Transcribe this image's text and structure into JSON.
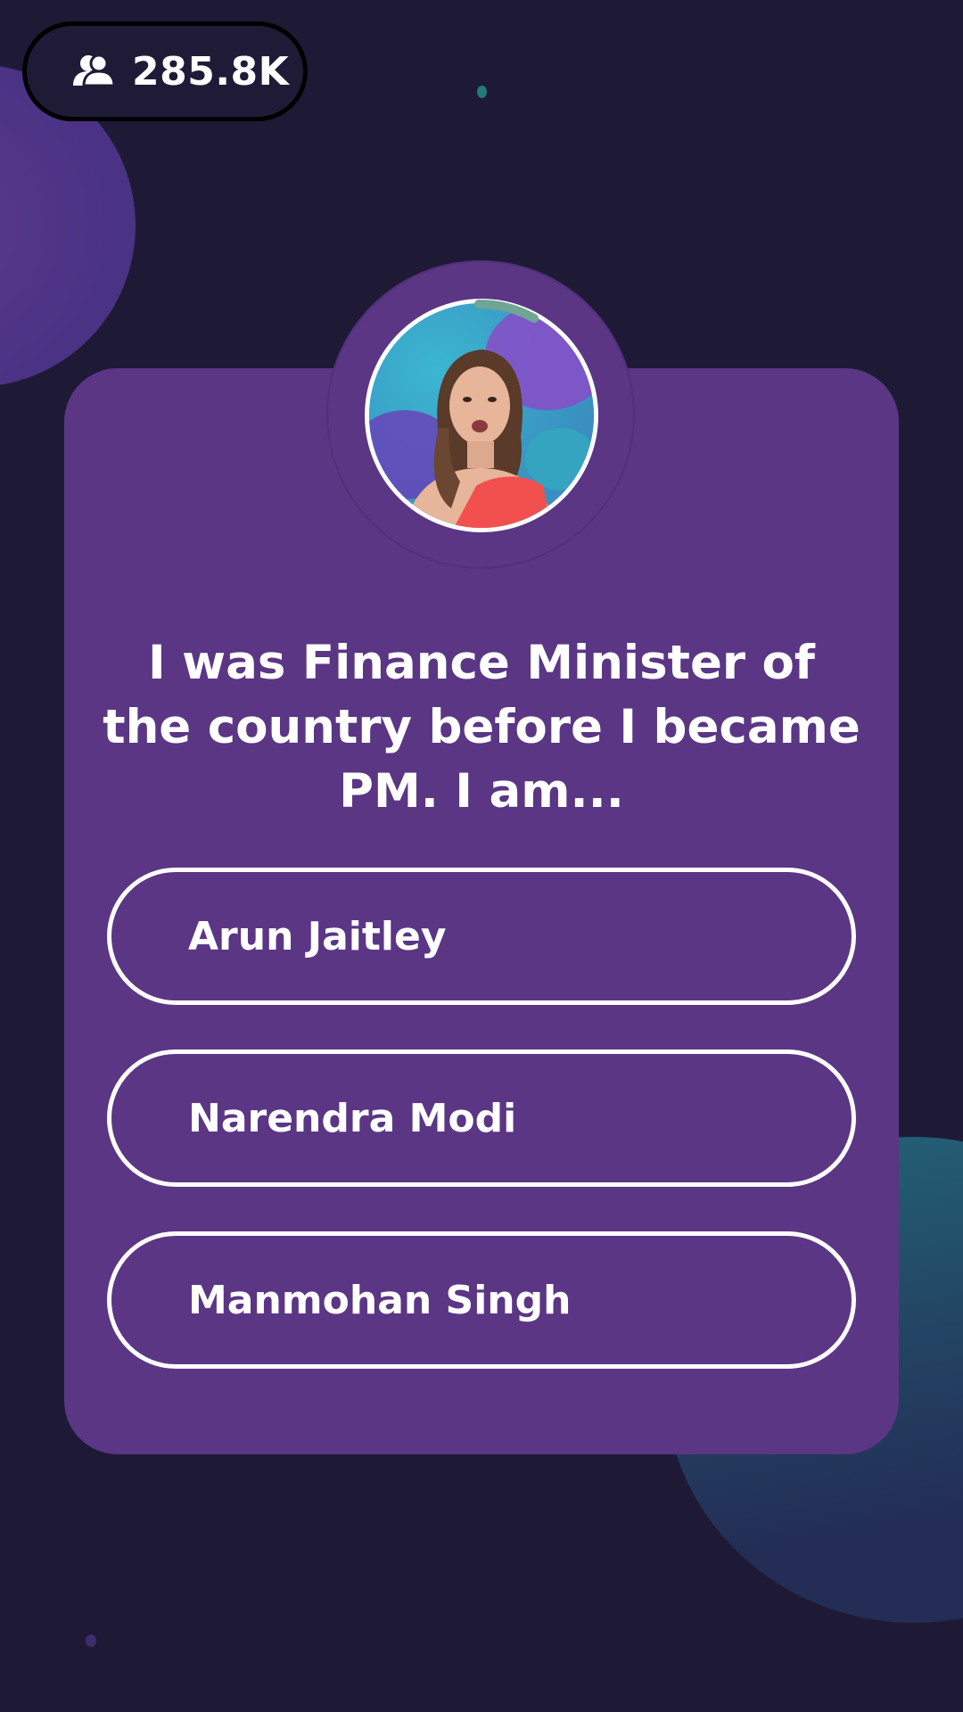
{
  "header": {
    "viewer_icon": "users-icon",
    "viewer_count": "285.8K"
  },
  "host": {
    "avatar_icon": "host-video-avatar"
  },
  "question": {
    "text": "I was Finance Minister of the country before I became PM. I am..."
  },
  "options": [
    {
      "label": "Arun Jaitley"
    },
    {
      "label": "Narendra Modi"
    },
    {
      "label": "Manmohan Singh"
    }
  ],
  "colors": {
    "background": "#1e1a36",
    "card": "#5a3684",
    "timer": "#6fa595",
    "text": "#ffffff"
  }
}
